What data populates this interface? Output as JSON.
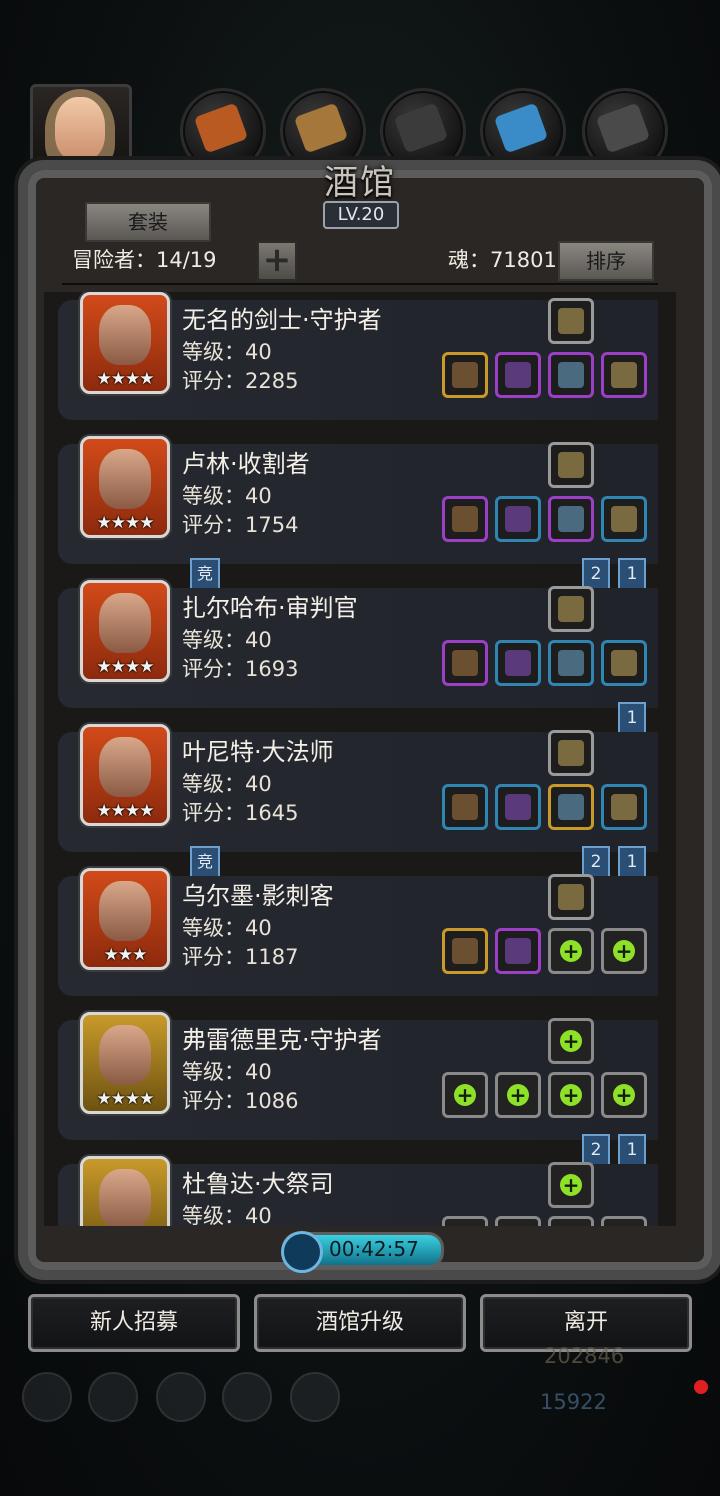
{
  "header": {
    "title": "酒馆",
    "level": "LV.20",
    "suit_button": "套装",
    "adventurers": "冒险者：14/19",
    "add_button": "+",
    "soul": "魂：71801",
    "sort_button": "排序"
  },
  "tabs": [
    {
      "icon": "hero-portrait-icon",
      "color": "#d8b07a"
    },
    {
      "icon": "armor-orange-icon",
      "color": "#b85a22"
    },
    {
      "icon": "wood-plank-icon",
      "color": "#a6773a"
    },
    {
      "icon": "dark-ore-icon",
      "color": "#3b3b3b"
    },
    {
      "icon": "blue-crystal-icon",
      "color": "#3a8cc9"
    },
    {
      "icon": "grey-ore-icon",
      "color": "#4a4a4a"
    }
  ],
  "heroes": [
    {
      "name": "无名的剑士·守护者",
      "level": "等级：40",
      "score": "评分：2285",
      "stars": "★★★★",
      "frame": "orange",
      "top_slot": "grey",
      "slots": [
        "gold",
        "purple",
        "purple",
        "purple"
      ],
      "badges": [],
      "jing": false
    },
    {
      "name": "卢林·收割者",
      "level": "等级：40",
      "score": "评分：1754",
      "stars": "★★★★",
      "frame": "orange",
      "top_slot": "grey",
      "slots": [
        "purple",
        "blue",
        "purple",
        "blue"
      ],
      "badges": [
        "2",
        "1"
      ],
      "jing": true
    },
    {
      "name": "扎尔哈布·审判官",
      "level": "等级：40",
      "score": "评分：1693",
      "stars": "★★★★",
      "frame": "orange",
      "top_slot": "grey",
      "slots": [
        "purple",
        "blue",
        "blue",
        "blue"
      ],
      "badges": [
        "1"
      ],
      "jing": false
    },
    {
      "name": "叶尼特·大法师",
      "level": "等级：40",
      "score": "评分：1645",
      "stars": "★★★★",
      "frame": "orange",
      "top_slot": "grey",
      "slots": [
        "blue",
        "blue",
        "gold",
        "blue"
      ],
      "badges": [
        "2",
        "1"
      ],
      "jing": true
    },
    {
      "name": "乌尔墨·影刺客",
      "level": "等级：40",
      "score": "评分：1187",
      "stars": "★★★",
      "frame": "orange",
      "top_slot": "grey",
      "slots": [
        "gold",
        "purple",
        "empty",
        "empty"
      ],
      "badges": [],
      "jing": false
    },
    {
      "name": "弗雷德里克·守护者",
      "level": "等级：40",
      "score": "评分：1086",
      "stars": "★★★★",
      "frame": "gold",
      "top_slot": "empty",
      "slots": [
        "empty",
        "empty",
        "empty",
        "empty"
      ],
      "badges": [
        "2",
        "1"
      ],
      "jing": false
    },
    {
      "name": "杜鲁达·大祭司",
      "level": "等级：40",
      "score": "",
      "stars": "",
      "frame": "gold",
      "top_slot": "empty",
      "slots": [
        "empty",
        "empty",
        "empty",
        "empty"
      ],
      "badges": [],
      "jing": false
    }
  ],
  "jing_label": "竞",
  "timer": "00:42:57",
  "buttons": {
    "recruit": "新人招募",
    "upgrade": "酒馆升级",
    "leave": "离开"
  },
  "resources": {
    "gold": "202846",
    "gems": "15922"
  },
  "colors": {
    "gold": "#c79a2a",
    "purple": "#9b3fc7",
    "blue": "#2f86b3",
    "grey": "#9a9a9a",
    "plus": "#8ee028"
  }
}
